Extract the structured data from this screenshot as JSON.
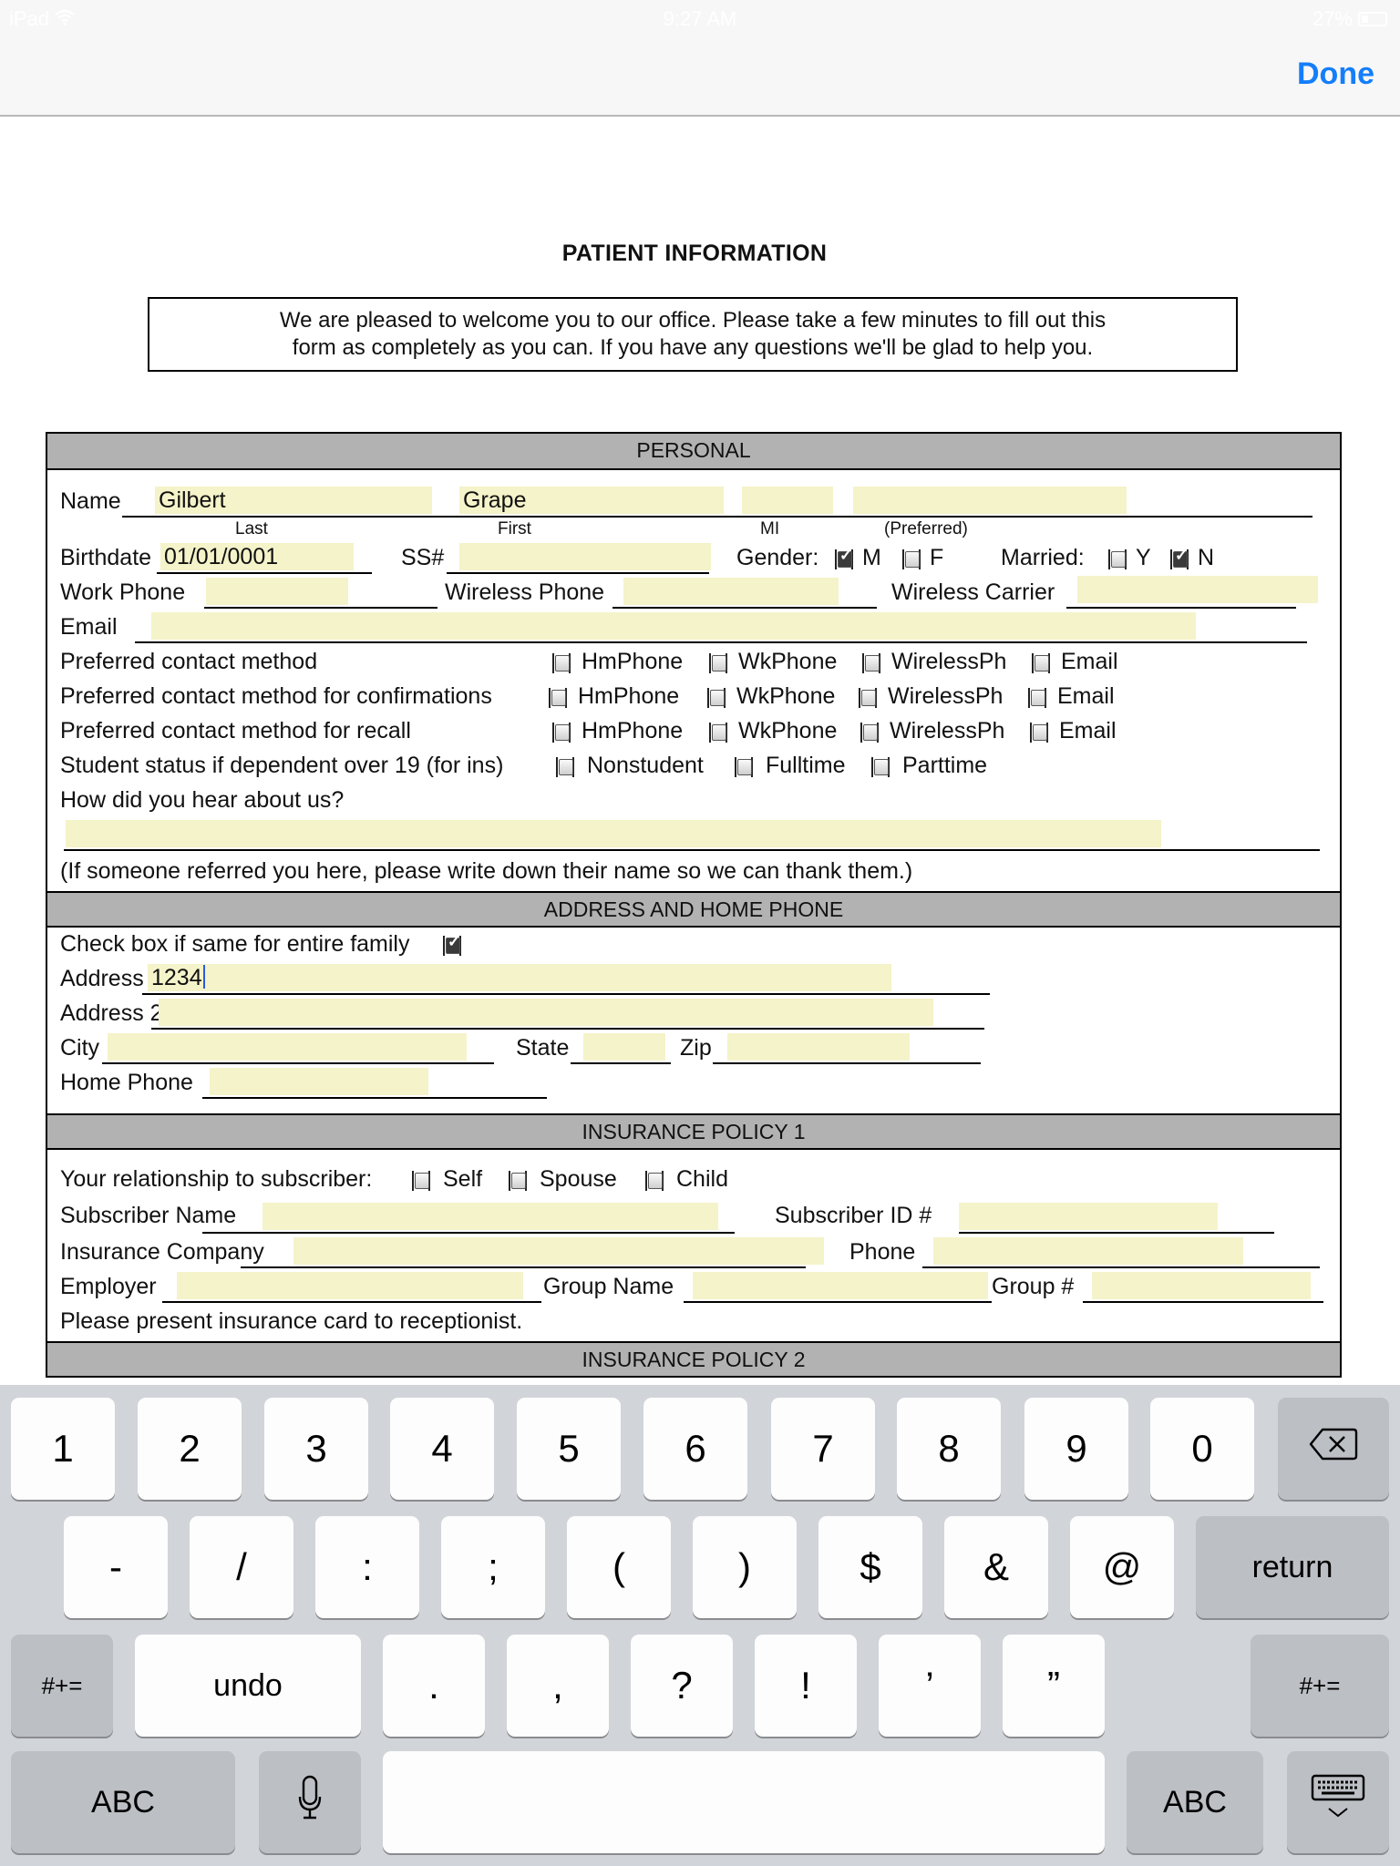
{
  "status_bar": {
    "device": "iPad",
    "time": "9:27 AM",
    "battery": "27%"
  },
  "nav": {
    "done_label": "Done",
    "accent": "#147efb"
  },
  "document": {
    "title": "PATIENT INFORMATION",
    "welcome_line1": "We are pleased to welcome you to our office.  Please take a few minutes to fill out this",
    "welcome_line2": "form as completely as you can. If you have any questions we'll be glad to help you.",
    "field_fill_color": "#f5f3c9",
    "sections": {
      "personal": {
        "header": "PERSONAL",
        "name_label": "Name",
        "name_last": "Gilbert",
        "name_first": "Grape",
        "name_mi": "",
        "name_preferred": "",
        "sub_last": "Last",
        "sub_first": "First",
        "sub_mi": "MI",
        "sub_preferred": "(Preferred)",
        "birthdate_label": "Birthdate",
        "birthdate": "01/01/0001",
        "ss_label": "SS#",
        "ss": "",
        "gender_label": "Gender:",
        "gender_m": {
          "label": "M",
          "checked": true
        },
        "gender_f": {
          "label": "F",
          "checked": false
        },
        "married_label": "Married:",
        "married_y": {
          "label": "Y",
          "checked": false
        },
        "married_n": {
          "label": "N",
          "checked": true
        },
        "work_phone_label": "Work Phone",
        "work_phone": "",
        "wireless_phone_label": "Wireless Phone",
        "wireless_phone": "",
        "wireless_carrier_label": "Wireless Carrier",
        "wireless_carrier": "",
        "email_label": "Email",
        "email": "",
        "contact_rows": [
          {
            "label": "Preferred contact method",
            "options": [
              "HmPhone",
              "WkPhone",
              "WirelessPh",
              "Email"
            ]
          },
          {
            "label": "Preferred contact method for confirmations",
            "options": [
              "HmPhone",
              "WkPhone",
              "WirelessPh",
              "Email"
            ]
          },
          {
            "label": "Preferred contact method for recall",
            "options": [
              "HmPhone",
              "WkPhone",
              "WirelessPh",
              "Email"
            ]
          }
        ],
        "student_label": "Student status if dependent over 19 (for ins)",
        "student_options": [
          "Nonstudent",
          "Fulltime",
          "Parttime"
        ],
        "hear_label": "How did you hear about us?",
        "hear_value": "",
        "referral_note": "(If someone referred you here, please write down their name so we can thank them.)"
      },
      "address": {
        "header": "ADDRESS AND HOME PHONE",
        "family_label": "Check box if same for entire family",
        "family_checked": true,
        "address_label": "Address",
        "address": "1234",
        "address2_label": "Address 2",
        "address2": "",
        "city_label": "City",
        "city": "",
        "state_label": "State",
        "state": "",
        "zip_label": "Zip",
        "zip": "",
        "home_phone_label": "Home Phone",
        "home_phone": ""
      },
      "insurance1": {
        "header": "INSURANCE POLICY 1",
        "relationship_label": "Your relationship to subscriber:",
        "relationship_options": [
          "Self",
          "Spouse",
          "Child"
        ],
        "subscriber_name_label": "Subscriber Name",
        "subscriber_name": "",
        "subscriber_id_label": "Subscriber ID #",
        "subscriber_id": "",
        "company_label": "Insurance Company",
        "company": "",
        "phone_label": "Phone",
        "phone": "",
        "employer_label": "Employer",
        "employer": "",
        "group_name_label": "Group Name",
        "group_name": "",
        "group_no_label": "Group #",
        "group_no": "",
        "note": "Please present insurance card to receptionist."
      },
      "insurance2": {
        "header": "INSURANCE POLICY 2"
      }
    }
  },
  "keyboard": {
    "row1": [
      "1",
      "2",
      "3",
      "4",
      "5",
      "6",
      "7",
      "8",
      "9",
      "0"
    ],
    "row2": [
      "-",
      "/",
      ":",
      ";",
      "(",
      ")",
      "$",
      "&",
      "@"
    ],
    "return_label": "return",
    "row3_left": "#+=",
    "undo_label": "undo",
    "row3": [
      ".",
      ",",
      "?",
      "!",
      "’",
      "”"
    ],
    "row3_right": "#+=",
    "abc_left": "ABC",
    "abc_right": "ABC",
    "icons": {
      "delete": "delete-icon",
      "mic": "microphone-icon",
      "dismiss": "keyboard-dismiss-icon"
    }
  }
}
